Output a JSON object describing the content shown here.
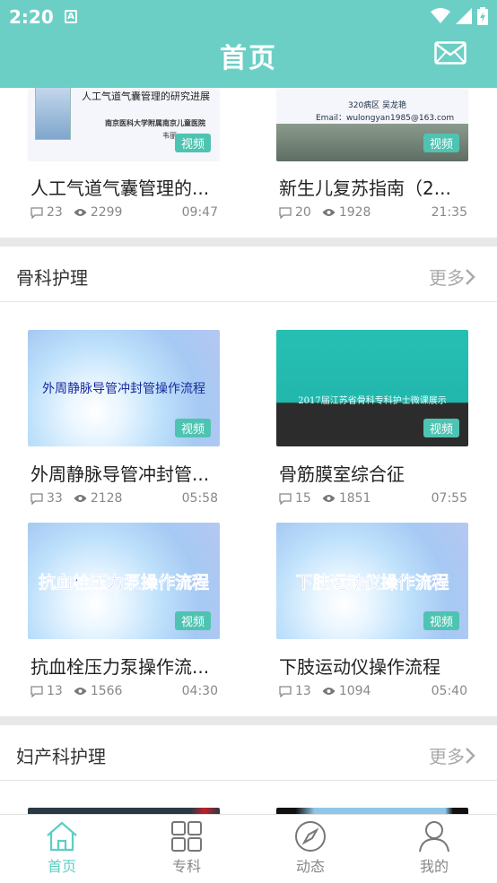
{
  "status": {
    "time": "2:20"
  },
  "header": {
    "title": "首页"
  },
  "top_cards": [
    {
      "title": "人工气道气囊管理的...",
      "comments": "23",
      "views": "2299",
      "time": "09:47",
      "badge": "视频",
      "thumb_lines": [
        "人工气道气囊管理的研究进展",
        "南京医科大学附属南京儿童医院",
        "韦丽"
      ]
    },
    {
      "title": "新生儿复苏指南（2...",
      "comments": "20",
      "views": "1928",
      "time": "21:35",
      "badge": "视频",
      "thumb_lines": [
        "320病区  吴龙艳",
        "Email：wulongyan1985@163.com"
      ]
    }
  ],
  "sections": [
    {
      "title": "骨科护理",
      "more": "更多",
      "cards": [
        {
          "title": "外周静脉导管冲封管...",
          "comments": "33",
          "views": "2128",
          "time": "05:58",
          "badge": "视频",
          "thumb_text": "外周静脉导管冲封管操作流程"
        },
        {
          "title": "骨筋膜室综合征",
          "comments": "15",
          "views": "1851",
          "time": "07:55",
          "badge": "视频",
          "thumb_text": "2017届江苏省骨科专科护士微课展示"
        },
        {
          "title": "抗血栓压力泵操作流...",
          "comments": "13",
          "views": "1566",
          "time": "04:30",
          "badge": "视频",
          "thumb_text": "抗血栓压力泵操作流程"
        },
        {
          "title": "下肢运动仪操作流程",
          "comments": "13",
          "views": "1094",
          "time": "05:40",
          "badge": "视频",
          "thumb_text": "下肢运动仪操作流程"
        }
      ]
    },
    {
      "title": "妇产科护理",
      "more": "更多",
      "cards": []
    }
  ],
  "bottom_nav": [
    {
      "label": "首页",
      "icon": "home-icon",
      "active": true
    },
    {
      "label": "专科",
      "icon": "grid-icon",
      "active": false
    },
    {
      "label": "动态",
      "icon": "compass-icon",
      "active": false
    },
    {
      "label": "我的",
      "icon": "person-icon",
      "active": false
    }
  ],
  "colors": {
    "primary": "#6ccfc5",
    "badge": "#4fc3b1",
    "active_nav": "#5ccfc2"
  }
}
